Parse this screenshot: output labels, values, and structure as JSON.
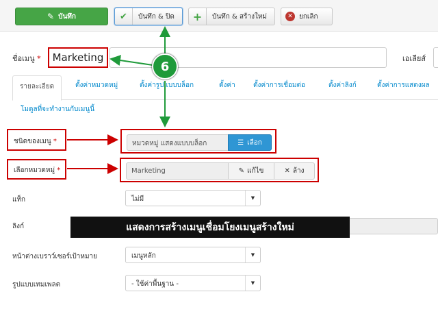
{
  "toolbar": {
    "save": "บันทึก",
    "save_close": "บันทึก & ปิด",
    "save_new": "บันทึก & สร้างใหม่",
    "cancel": "ยกเลิก"
  },
  "title_field": {
    "label": "ชื่อเมนู",
    "required_mark": "*",
    "value": "Marketing"
  },
  "alias_field": {
    "label": "เอเลียส์"
  },
  "step_badge": "6",
  "tabs": [
    "รายละเอียด",
    "ตั้งค่าหมวดหมู่",
    "ตั้งค่ารูปแบบบล็อก",
    "ตั้งค่า",
    "ตั้งค่าการเชื่อมต่อ",
    "ตั้งค่าลิงก์",
    "ตั้งค่าการแสดงผล",
    "โมดูลที่จะทำงานกับเมนูนี้"
  ],
  "menu_type": {
    "label": "ชนิดของเมนู",
    "required_mark": "*",
    "value": "หมวดหมู่ แสดงแบบบล็อก",
    "select_button": "เลือก"
  },
  "category": {
    "label": "เลือกหมวดหมู่",
    "required_mark": "*",
    "value": "Marketing",
    "edit_button": "แก้ไข",
    "clear_button": "ล้าง"
  },
  "tags": {
    "label": "แท็ก",
    "value": "ไม่มี"
  },
  "link": {
    "label": "ลิงก์"
  },
  "banner": "แสดงการสร้างเมนูเชื่อมโยงเมนูสร้างใหม่",
  "target_window": {
    "label": "หน้าต่างเบราว์เซอร์เป้าหมาย",
    "value": "เมนูหลัก"
  },
  "template_style": {
    "label": "รูปแบบเทมเพลต",
    "value": "- ใช้ค่าพื้นฐาน -"
  },
  "colors": {
    "save_green": "#46a546",
    "annotation_red": "#cc0000",
    "badge_green": "#1f9a3a",
    "select_blue": "#2f96d4"
  }
}
